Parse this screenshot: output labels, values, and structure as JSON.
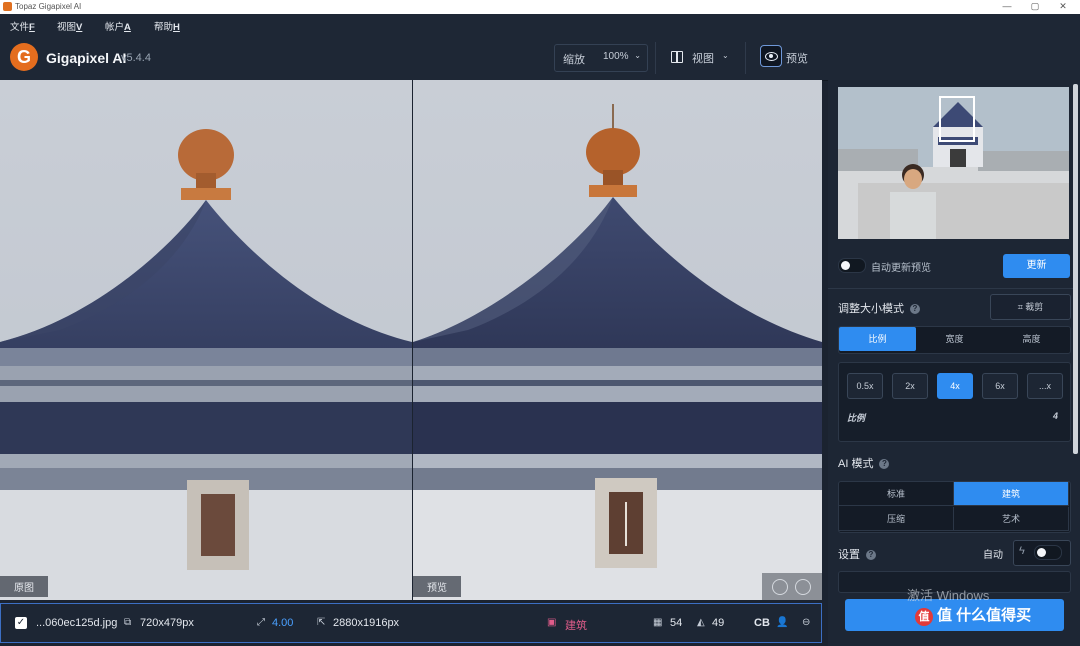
{
  "window": {
    "title": "Topaz Gigapixel AI",
    "controls": [
      "—",
      "▢",
      "✕"
    ]
  },
  "menu": [
    {
      "label": "文件",
      "key": "F"
    },
    {
      "label": "视图",
      "key": "V"
    },
    {
      "label": "帐户",
      "key": "A"
    },
    {
      "label": "帮助",
      "key": "H"
    }
  ],
  "toolbar": {
    "app_name": "Gigapixel AI",
    "version": "v5.4.4",
    "zoom_label": "缩放",
    "zoom_value": "100%",
    "view_label": "视图",
    "preview_label": "预览"
  },
  "stage": {
    "original_label": "原图",
    "preview_label": "预览"
  },
  "status": {
    "filename": "...060ec125d.jpg",
    "input_size": "720x479px",
    "scale": "4.00",
    "output_size": "2880x1916px",
    "model": "建筑",
    "noise": "54",
    "blur": "49",
    "face_label": "CB"
  },
  "sidebar": {
    "auto_update_label": "自动更新预览",
    "update_button": "更新",
    "resize_mode_label": "调整大小模式",
    "crop_button": "裁剪",
    "resize_tabs": [
      "比例",
      "宽度",
      "高度"
    ],
    "resize_active": 0,
    "scale_options": [
      "0.5x",
      "2x",
      "4x",
      "6x",
      "...x"
    ],
    "scale_active": 2,
    "scale_label": "比例",
    "scale_value": "4",
    "ai_mode_label": "AI 模式",
    "ai_modes": [
      "标准",
      "建筑",
      "压缩",
      "艺术"
    ],
    "ai_active": 1,
    "settings_label": "设置",
    "auto_label": "自动"
  },
  "overlay": {
    "watermark": "激活 Windows",
    "brand": "值 什么值得买"
  },
  "colors": {
    "accent": "#2f8cf0",
    "logo": "#e46d1e",
    "panel": "#1d2634"
  }
}
